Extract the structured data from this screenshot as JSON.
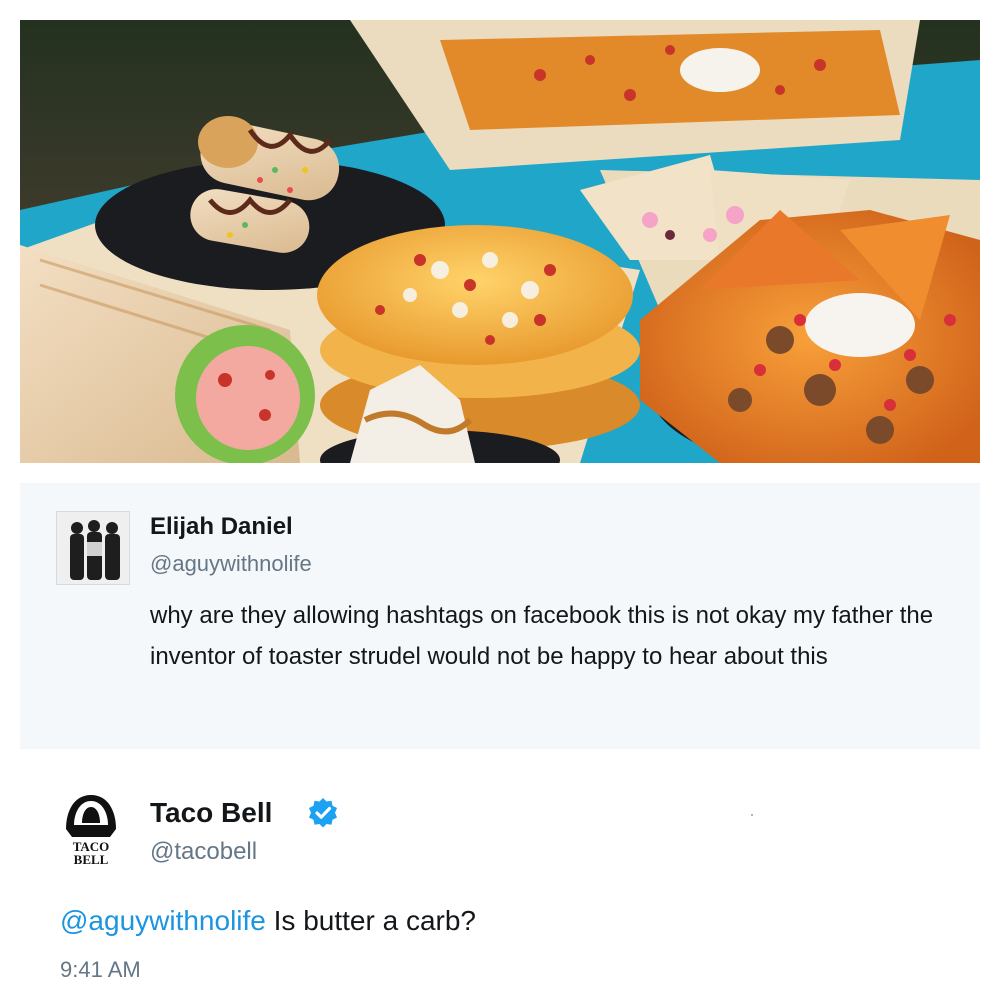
{
  "quoted_tweet": {
    "name": "Elijah Daniel",
    "handle": "@aguywithnolife",
    "text": "why are they allowing hashtags on facebook this is not okay my father the inventor of toaster strudel would not be happy to hear about this"
  },
  "reply_tweet": {
    "name": "Taco Bell",
    "handle": "@tacobell",
    "logo_text_line1": "TACO",
    "logo_text_line2": "BELL",
    "mention": "@aguywithnolife",
    "text": " Is butter a carb?",
    "time": "9:41 AM"
  },
  "colors": {
    "link": "#1b95e0",
    "verified_badge": "#1da1f2",
    "secondary_text": "#657786",
    "quoted_background": "#f5f8fa"
  }
}
